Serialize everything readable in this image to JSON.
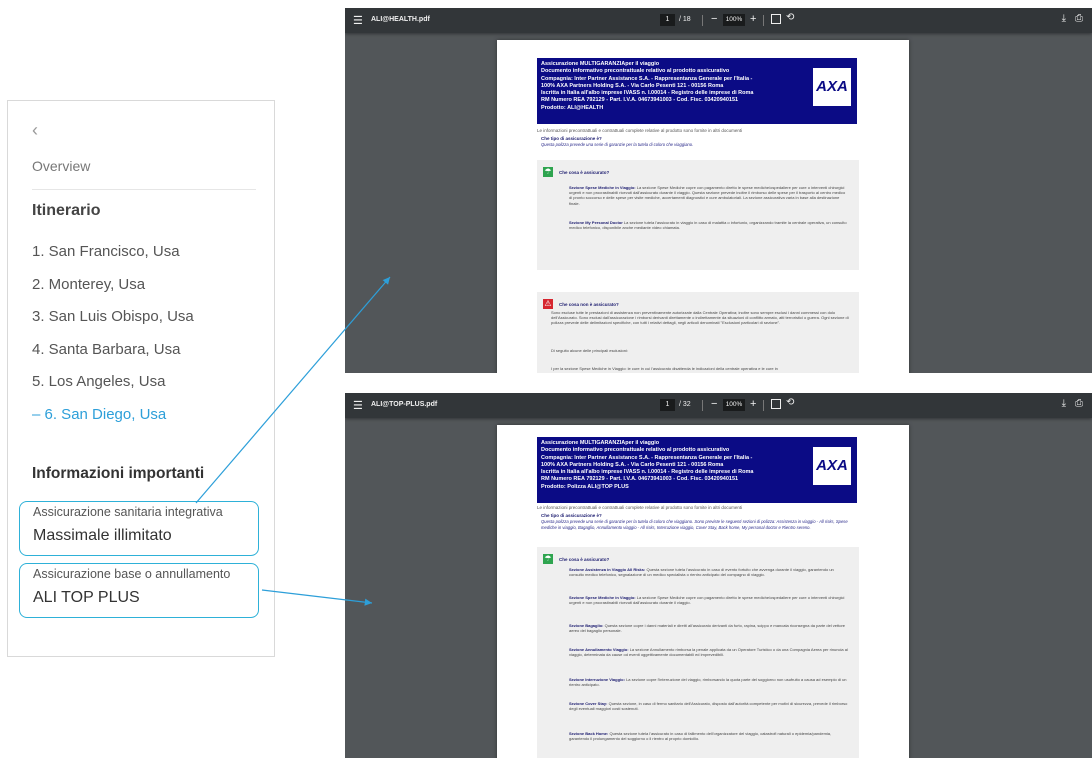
{
  "sidebar": {
    "back_icon": "chevron-left-icon",
    "overview": "Overview",
    "itinerary_title": "Itinerario",
    "itinerary": [
      {
        "label": "1. San Francisco, Usa",
        "active": false
      },
      {
        "label": "2. Monterey, Usa",
        "active": false
      },
      {
        "label": "3. San Luis Obispo, Usa",
        "active": false
      },
      {
        "label": "4. Santa Barbara, Usa",
        "active": false
      },
      {
        "label": "5. Los Angeles, Usa",
        "active": false
      },
      {
        "label": "– 6. San Diego, Usa",
        "active": true
      }
    ],
    "info_title": "Informazioni importanti",
    "cards": [
      {
        "label": "Assicurazione sanitaria integrativa",
        "value": "Massimale illimitato"
      },
      {
        "label": "Assicurazione base o annullamento",
        "value": "ALI TOP PLUS"
      }
    ]
  },
  "colors": {
    "accent": "#2d9fd9",
    "card_border": "#2eb1d8",
    "axa_blue": "#0b0b85",
    "toolbar": "#323639",
    "viewer_bg": "#525659"
  },
  "viewer1": {
    "filename": "ALI@HEALTH.pdf",
    "page": "1",
    "total": "/ 18",
    "zoom": "100%",
    "header_lines": [
      "Assicurazione MULTIGARANZIAper il viaggio",
      "Documento informativo precontrattuale relativo al prodotto assicurativo",
      "Compagnia: Inter Partner Assistance S.A. - Rappresentanza Generale per l'Italia -",
      "100% AXA Partners Holding S.A. - Via Carlo Pesenti 121 - 00156 Roma",
      "Iscritta in Italia all'albo imprese IVASS n. I.00014 - Registro delle imprese di Roma",
      "RM Numero REA 792129 - Part. I.V.A. 04673941003 - Cod. Fisc. 03420940151",
      "Prodotto: ALI@HEALTH"
    ],
    "logo": "AXA",
    "intro": "Le informazioni precontrattuali e contrattuali complete relative al prodotto sono fornite in altri documenti",
    "question": "Che tipo di assicurazione è?",
    "answer": "Questa polizza prevede una serie di garanzie per la tutela di coloro che viaggiano.",
    "box1_title": "Che cosa è assicurato?",
    "box1_sections": [
      {
        "name": "Sezione Spese Mediche in Viaggio:",
        "text": "La sezione Spese Mediche copre con pagamento diretto le spese mediche/ospedaliere per cure o interventi chirurgici urgenti e non procrastinabili ricevuti dall'assicurato durante il viaggio. Questa sezione prevede inoltre il rimborso delle spese per il trasporto al centro medico di pronto soccorso e delle spese per visite mediche, accertamenti diagnostici e cure ambulatoriali. La sezione assicurativa varia in base alla destinazione finale."
      },
      {
        "name": "Sezione My Personal Doctor",
        "text": "La sezione tutela l'assicurato in viaggio in caso di malattia o infortunio, organizzando tramite la centrale operativa, un consulto medico telefonico, disponibile anche mediante video chiamata."
      }
    ],
    "box2_title": "Che cosa non è assicurato?",
    "box2_text": "Sono escluse tutte le prestazioni di assistenza non preventivamente autorizzate dalla Centrale Operativa; inoltre sono sempre esclusi i danni commessi con dolo dell'Assicurato. Sono esclusi dall'assicurazione i rimborsi derivanti direttamente o indirettamente da situazioni di conflitto armato, atti terroristici o guerra. Ogni sezione di polizza prevede delle delimitazioni specifiche, con tutti i relativi dettagli, negli articoli denominati \"Esclusioni particolari di sezione\".",
    "box2_note": "Di seguito alcune delle principali esclusioni:",
    "box2_cut": "I per la sezione Spese Mediche in Viaggio: le cure in cui l'assicurato disattenda le indicazioni della centrale operativa e le cure in"
  },
  "viewer2": {
    "filename": "ALI@TOP-PLUS.pdf",
    "page": "1",
    "total": "/ 32",
    "zoom": "100%",
    "header_lines": [
      "Assicurazione MULTIGARANZIAper il viaggio",
      "Documento informativo precontrattuale relativo al prodotto assicurativo",
      "Compagnia: Inter Partner Assistance S.A. - Rappresentanza Generale per l'Italia -",
      "100% AXA Partners Holding S.A. - Via Carlo Pesenti 121 - 00156 Roma",
      "Iscritta in Italia all'albo imprese IVASS n. I.00014 - Registro delle imprese di Roma",
      "RM Numero REA 792129 - Part. I.V.A. 04673941003 - Cod. Fisc. 03420940151",
      "Prodotto: Polizza ALI@TOP PLUS"
    ],
    "logo": "AXA",
    "intro": "Le informazioni precontrattuali e contrattuali complete relative al prodotto sono fornite in altri documenti",
    "question": "Che tipo di assicurazione è?",
    "answer": "Questa polizza prevede una serie di garanzie per la tutela di coloro che viaggiano. Sono previste le seguenti sezioni di polizza: Assistenza in viaggio - All risks, Spese mediche in viaggio, Bagaglio, Annullamento viaggio - All risks, Interruzione viaggio, Cover Stay, Back home, My personal doctor e Rientro sereno.",
    "box1_title": "Che cosa è assicurato?",
    "box1_sections": [
      {
        "name": "Sezione Assistenza in Viaggio All Risks:",
        "text": "Questa sezione tutela l'assicurato in caso di evento fortuito che avvenga durante il viaggio, garantendo un consulto medico telefonico, segnalazione di un medico specialista o rientro anticipato del compagno di viaggio."
      },
      {
        "name": "Sezione Spese Mediche in Viaggio:",
        "text": "La sezione Spese Mediche copre con pagamento diretto le spese mediche/ospedaliere per cure o interventi chirurgici urgenti e non procrastinabili ricevuti dall'assicurato durante il viaggio."
      },
      {
        "name": "Sezione Bagaglio:",
        "text": "Questa sezione copre i danni materiali e diretti all'assicurato derivanti da furto, rapina, scippo e mancata riconsegna da parte del vettore aereo del bagaglio personale."
      },
      {
        "name": "Sezione Annullamento Viaggio:",
        "text": "La sezione Annullamento rimborsa la penale applicata da un Operatore Turistico o da una Compagnia Aerea per rinuncia al viaggio, determinata da cause od eventi oggettivamente documentabili ed imprevedibili."
      },
      {
        "name": "Sezione Interruzione Viaggio:",
        "text": "La sezione copre l'interruzione del viaggio, rimborsando la quota parte del soggiorno non usufruito a causa ad esempio di un rientro anticipato."
      },
      {
        "name": "Sezione Cover Stay:",
        "text": "Questa sezione, in caso di fermo sanitario dell'Assicurato, disposto dall'autorità competente per motivi di sicurezza, prevede il rimborso degli eventuali maggiori costi sostenuti."
      },
      {
        "name": "Sezione Back Home:",
        "text": "Questa sezione tutela l'assicurato in caso di fallimento dell'organizzatore del viaggio, catastrofi naturali o epidemia/pandemia, garantendo il prolungamento del soggiorno o il rientro al proprio domicilio."
      }
    ]
  }
}
